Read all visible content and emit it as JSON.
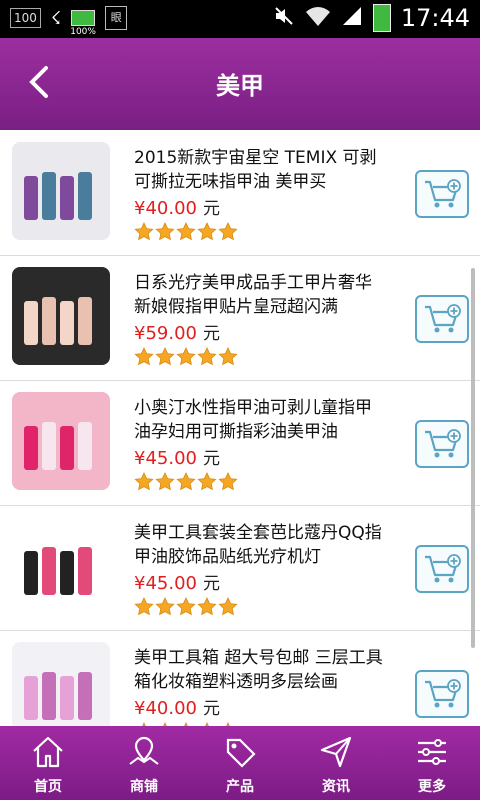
{
  "statusbar": {
    "notif_badge": "100",
    "battery_small_pct": "100%",
    "ime_glyph": "眼",
    "time": "17:44"
  },
  "header": {
    "title": "美甲"
  },
  "products": [
    {
      "name": "2015新款宇宙星空 TEMIX 可剥可撕拉无味指甲油 美甲买",
      "price": "¥40.00",
      "unit": "元",
      "rating": 5,
      "thumb_colors": [
        "#e9e9ee",
        "#7f4a9c",
        "#4a7c9c"
      ]
    },
    {
      "name": "日系光疗美甲成品手工甲片奢华新娘假指甲贴片皇冠超闪满",
      "price": "¥59.00",
      "unit": "元",
      "rating": 5,
      "thumb_colors": [
        "#2a2a2a",
        "#f3d6c8",
        "#e9c1b0"
      ]
    },
    {
      "name": "小奥汀水性指甲油可剥儿童指甲油孕妇用可撕指彩油美甲油",
      "price": "¥45.00",
      "unit": "元",
      "rating": 5,
      "thumb_colors": [
        "#f3b6c9",
        "#e0246a",
        "#f8e6ee"
      ]
    },
    {
      "name": "美甲工具套装全套芭比蔻丹QQ指甲油胶饰品贴纸光疗机灯",
      "price": "¥45.00",
      "unit": "元",
      "rating": 5,
      "thumb_colors": [
        "#ffffff",
        "#222222",
        "#e24a7a"
      ]
    },
    {
      "name": "美甲工具箱 超大号包邮 三层工具箱化妆箱塑料透明多层绘画",
      "price": "¥40.00",
      "unit": "元",
      "rating": 5,
      "thumb_colors": [
        "#f2f2f6",
        "#e6a1d6",
        "#c46fb8"
      ]
    }
  ],
  "tabs": [
    {
      "label": "首页",
      "icon": "home-icon",
      "active": true
    },
    {
      "label": "商铺",
      "icon": "map-pin-icon",
      "active": false
    },
    {
      "label": "产品",
      "icon": "sale-tag-icon",
      "active": false
    },
    {
      "label": "资讯",
      "icon": "send-icon",
      "active": false
    },
    {
      "label": "更多",
      "icon": "sliders-icon",
      "active": false
    }
  ],
  "colors": {
    "accent": "#8b2a92",
    "price": "#e02020",
    "star": "#f5a623",
    "cart": "#5aa4c4"
  }
}
